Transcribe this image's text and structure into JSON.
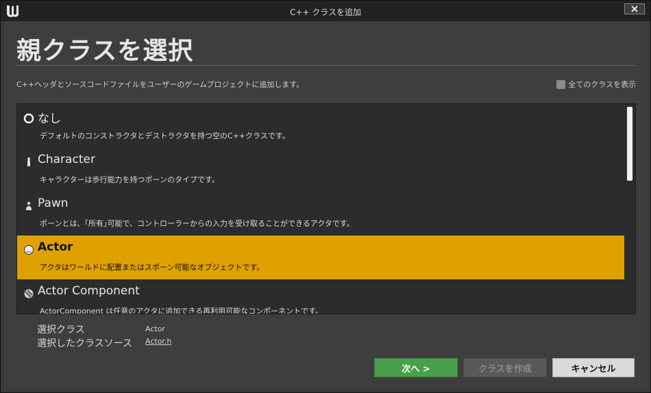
{
  "window": {
    "title": "C++ クラスを追加",
    "close_icon": "close-icon"
  },
  "page": {
    "heading": "親クラスを選択",
    "description": "C++ヘッダとソースコードファイルをユーザーのゲームプロジェクトに追加します。",
    "show_all_label": "全てのクラスを表示",
    "show_all_checked": false
  },
  "class_list": {
    "items": [
      {
        "name": "なし",
        "desc": "デフォルトのコンストラクタとデストラクタを持つ空のC++クラスです。",
        "icon": "circle-outline-icon",
        "selected": false
      },
      {
        "name": "Character",
        "desc": "キャラクターは歩行能力を持つポーンのタイプです。",
        "icon": "character-icon",
        "selected": false
      },
      {
        "name": "Pawn",
        "desc": "ポーンとは、｢所有｣可能で、コントローラーからの入力を受け取ることができるアクタです。",
        "icon": "pawn-icon",
        "selected": false
      },
      {
        "name": "Actor",
        "desc": "アクタはワールドに配置またはスポーン可能なオブジェクトです。",
        "icon": "actor-sphere-icon",
        "selected": true
      },
      {
        "name": "Actor Component",
        "desc": "ActorComponent は任意のアクタに追加できる再利用可能なコンポーネントです。",
        "icon": "actor-component-icon",
        "selected": false
      }
    ]
  },
  "info": {
    "selected_class_label": "選択クラス",
    "selected_class_value": "Actor",
    "source_label": "選択したクラスソース",
    "source_value": "Actor.h"
  },
  "buttons": {
    "next": "次へ >",
    "create": "クラスを作成",
    "cancel": "キャンセル"
  },
  "colors": {
    "selection": "#e0a100",
    "next_button": "#4aa04a"
  }
}
